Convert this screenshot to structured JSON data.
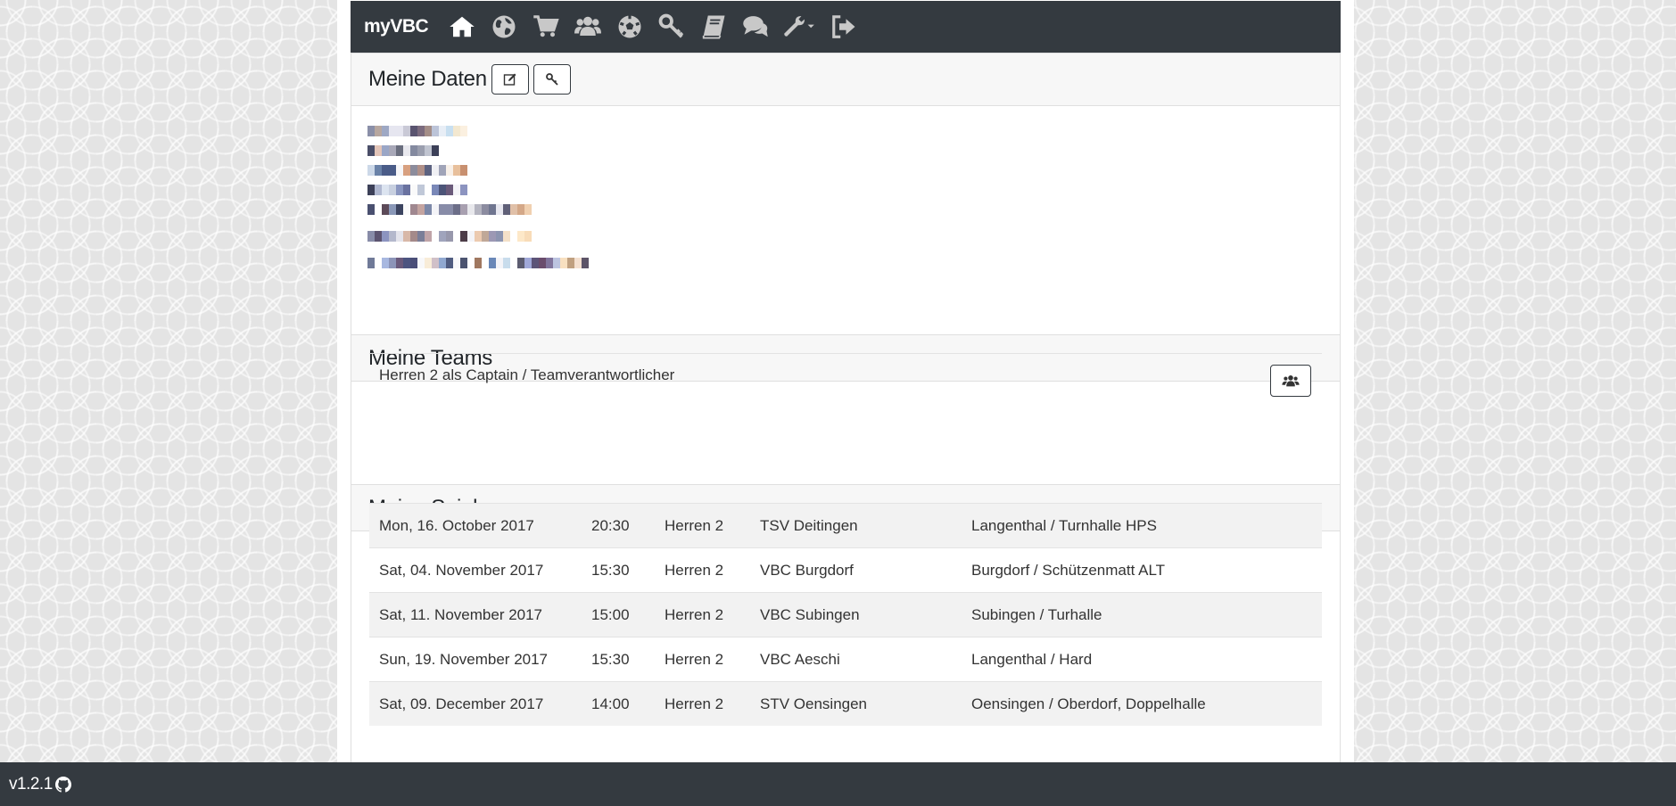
{
  "navbar": {
    "brand": "myVBC",
    "icons": [
      "home-icon",
      "globe-icon",
      "cart-icon",
      "users-icon",
      "soccer-ball-icon",
      "key-icon",
      "book-icon",
      "comments-icon",
      "wrench-icon",
      "sign-out-icon"
    ]
  },
  "data_card": {
    "title": "Meine Daten",
    "edit_icon": "edit-icon",
    "key_icon": "key-icon"
  },
  "teams_card": {
    "title": "Meine Teams",
    "team_text": "Herren 2 als Captain / Teamverantwortlicher",
    "team_button_icon": "users-icon"
  },
  "games_card": {
    "title": "Meine Spiele",
    "rows": [
      {
        "date": "Mon, 16. October 2017",
        "time": "20:30",
        "team": "Herren 2",
        "opponent": "TSV Deitingen",
        "location": "Langenthal / Turnhalle HPS"
      },
      {
        "date": "Sat, 04. November 2017",
        "time": "15:30",
        "team": "Herren 2",
        "opponent": "VBC Burgdorf",
        "location": "Burgdorf / Schützenmatt ALT"
      },
      {
        "date": "Sat, 11. November 2017",
        "time": "15:00",
        "team": "Herren 2",
        "opponent": "VBC Subingen",
        "location": "Subingen / Turhalle"
      },
      {
        "date": "Sun, 19. November 2017",
        "time": "15:30",
        "team": "Herren 2",
        "opponent": "VBC Aeschi",
        "location": "Langenthal / Hard"
      },
      {
        "date": "Sat, 09. December 2017",
        "time": "14:00",
        "team": "Herren 2",
        "opponent": "STV Oensingen",
        "location": "Oensingen / Oberdorf, Doppelhalle"
      }
    ]
  },
  "footer": {
    "version": "v1.2.1",
    "github_icon": "github-icon"
  }
}
